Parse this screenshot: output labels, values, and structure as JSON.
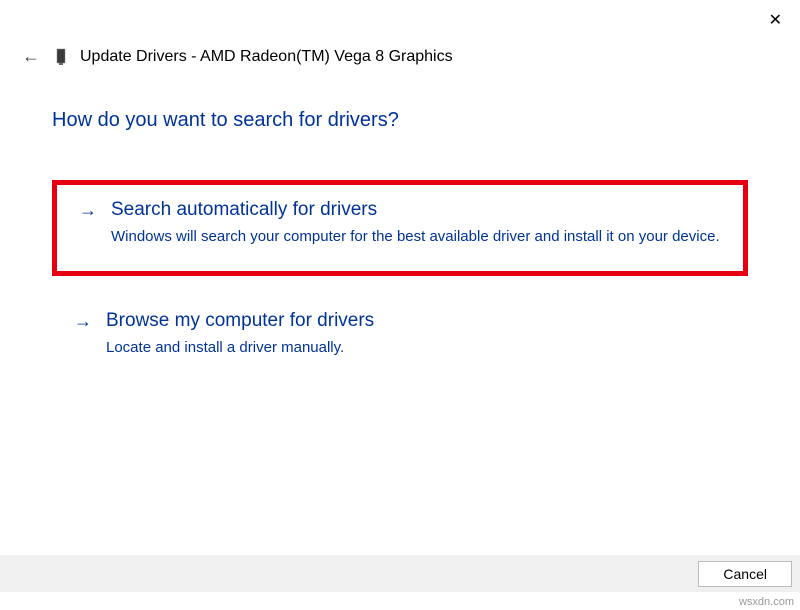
{
  "window": {
    "title": "Update Drivers - AMD Radeon(TM) Vega 8 Graphics"
  },
  "content": {
    "question": "How do you want to search for drivers?"
  },
  "options": [
    {
      "title": "Search automatically for drivers",
      "description": "Windows will search your computer for the best available driver and install it on your device."
    },
    {
      "title": "Browse my computer for drivers",
      "description": "Locate and install a driver manually."
    }
  ],
  "buttons": {
    "cancel": "Cancel"
  },
  "watermark": "wsxdn.com"
}
